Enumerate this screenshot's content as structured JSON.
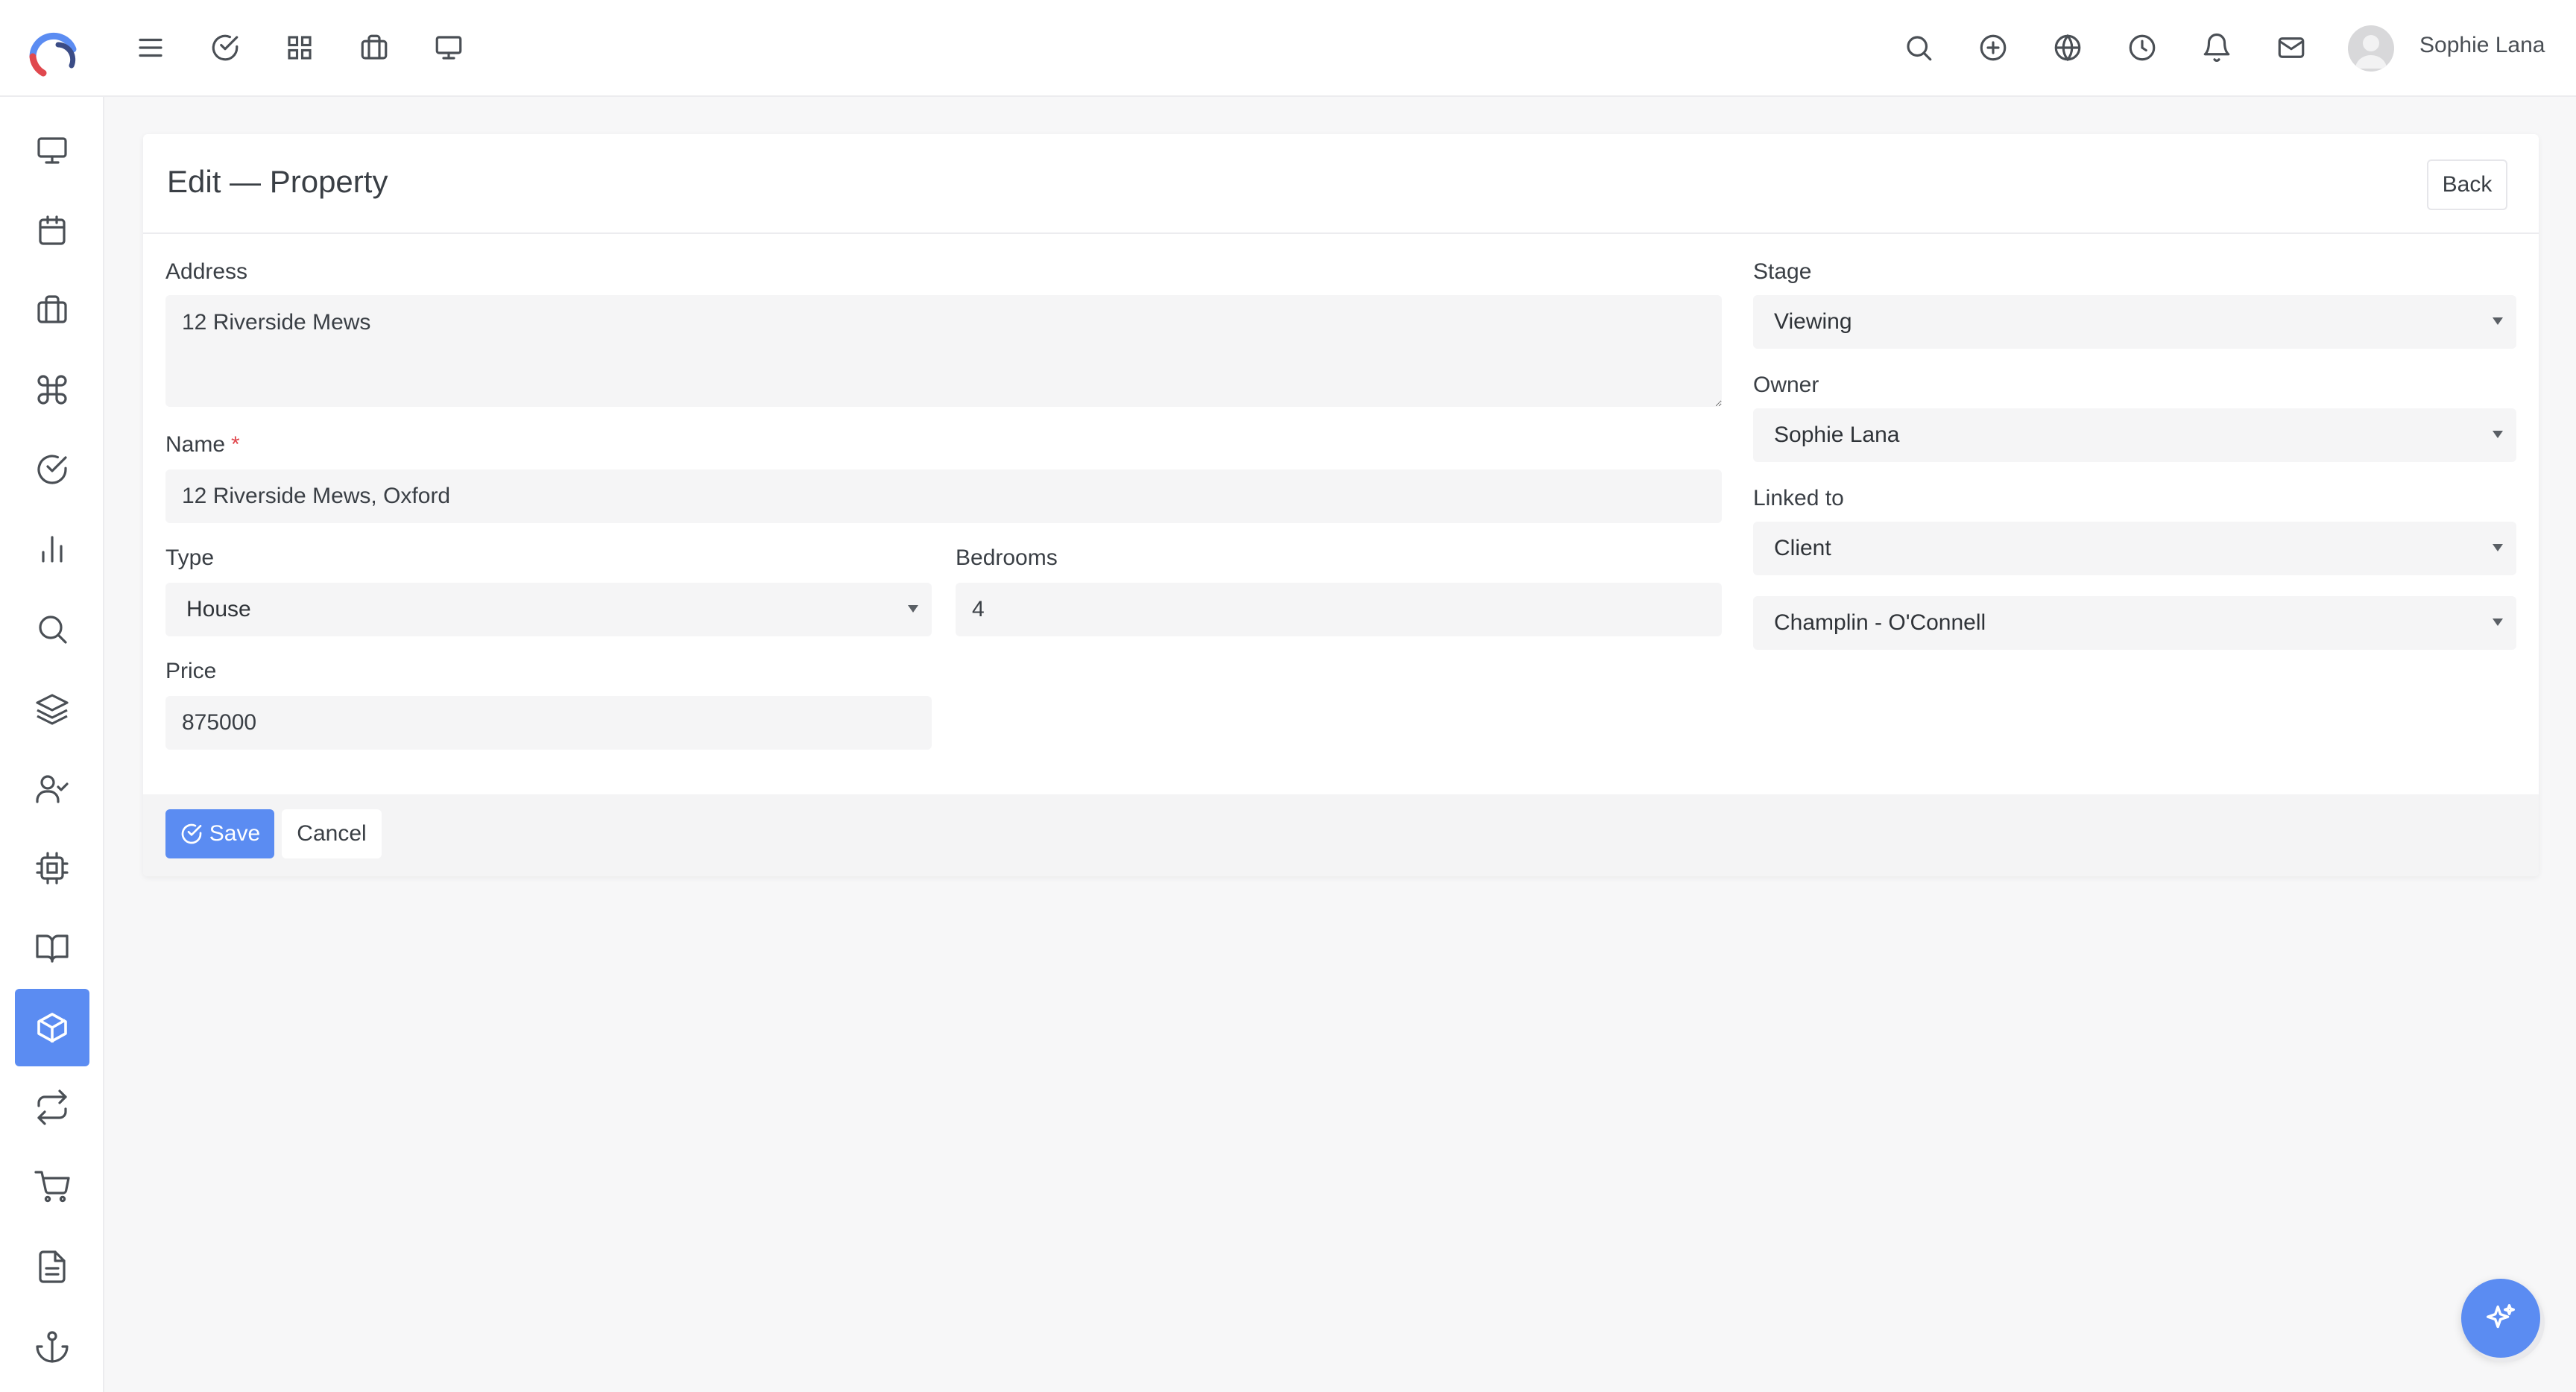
{
  "app": {
    "title": "Edit — Property",
    "back_label": "Back"
  },
  "topbar": {
    "left_icons": [
      "menu-icon",
      "check-circle-icon",
      "grid-icon",
      "briefcase-icon",
      "monitor-icon"
    ],
    "right_icons": [
      "search-icon",
      "plus-circle-icon",
      "globe-icon",
      "clock-icon",
      "bell-icon",
      "mail-icon"
    ],
    "user": {
      "name": "Sophie Lana"
    }
  },
  "sidebar": {
    "items": [
      {
        "icon": "monitor-icon",
        "active": false
      },
      {
        "icon": "calendar-icon",
        "active": false
      },
      {
        "icon": "briefcase-icon",
        "active": false
      },
      {
        "icon": "command-icon",
        "active": false
      },
      {
        "icon": "check-circle-icon",
        "active": false
      },
      {
        "icon": "bar-chart-icon",
        "active": false
      },
      {
        "icon": "search-icon",
        "active": false
      },
      {
        "icon": "layers-icon",
        "active": false
      },
      {
        "icon": "user-check-icon",
        "active": false
      },
      {
        "icon": "cpu-icon",
        "active": false
      },
      {
        "icon": "book-open-icon",
        "active": false
      },
      {
        "icon": "package-icon",
        "active": true
      },
      {
        "icon": "repeat-icon",
        "active": false
      },
      {
        "icon": "shopping-cart-icon",
        "active": false
      },
      {
        "icon": "file-text-icon",
        "active": false
      },
      {
        "icon": "anchor-icon",
        "active": false
      }
    ]
  },
  "form": {
    "address": {
      "label": "Address",
      "value": "12 Riverside Mews"
    },
    "name": {
      "label": "Name",
      "required_mark": "*",
      "value": "12 Riverside Mews, Oxford"
    },
    "type": {
      "label": "Type",
      "value": "House"
    },
    "bedrooms": {
      "label": "Bedrooms",
      "value": "4"
    },
    "price": {
      "label": "Price",
      "value": "875000"
    },
    "stage": {
      "label": "Stage",
      "value": "Viewing"
    },
    "owner": {
      "label": "Owner",
      "value": "Sophie Lana"
    },
    "linked_to": {
      "label": "Linked to",
      "value": "Client",
      "related_value": "Champlin - O'Connell"
    }
  },
  "footer": {
    "save_label": "Save",
    "cancel_label": "Cancel"
  },
  "colors": {
    "accent": "#5b8cf2",
    "required": "#e0484e",
    "field_bg": "#f5f5f6"
  }
}
